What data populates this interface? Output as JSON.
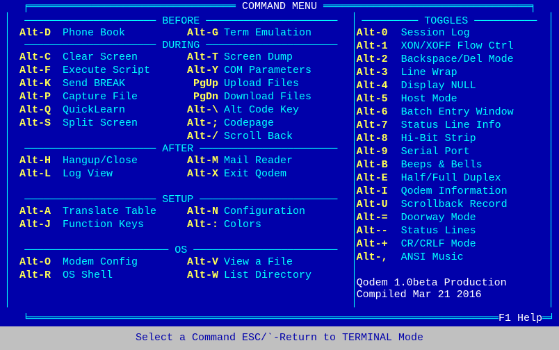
{
  "title": "COMMAND MENU",
  "left": {
    "sections": [
      {
        "name": "BEFORE",
        "rows": [
          {
            "k1": "Alt-D",
            "l1": "Phone Book",
            "k2": "Alt-G",
            "l2": "Term Emulation"
          }
        ]
      },
      {
        "name": "DURING",
        "rows": [
          {
            "k1": "Alt-C",
            "l1": "Clear Screen",
            "k2": "Alt-T",
            "l2": "Screen Dump"
          },
          {
            "k1": "Alt-F",
            "l1": "Execute Script",
            "k2": "Alt-Y",
            "l2": "COM Parameters"
          },
          {
            "k1": "Alt-K",
            "l1": "Send BREAK",
            "k2": "PgUp",
            "l2": "Upload Files"
          },
          {
            "k1": "Alt-P",
            "l1": "Capture File",
            "k2": "PgDn",
            "l2": "Download Files"
          },
          {
            "k1": "Alt-Q",
            "l1": "QuickLearn",
            "k2": "Alt-\\",
            "l2": "Alt Code Key"
          },
          {
            "k1": "Alt-S",
            "l1": "Split Screen",
            "k2": "Alt-;",
            "l2": "Codepage"
          },
          {
            "k1": "",
            "l1": "",
            "k2": "Alt-/",
            "l2": "Scroll Back"
          }
        ]
      },
      {
        "name": "AFTER",
        "rows": [
          {
            "k1": "Alt-H",
            "l1": "Hangup/Close",
            "k2": "Alt-M",
            "l2": "Mail Reader"
          },
          {
            "k1": "Alt-L",
            "l1": "Log View",
            "k2": "Alt-X",
            "l2": "Exit Qodem"
          }
        ]
      },
      {
        "name": "SETUP",
        "rows": [
          {
            "k1": "Alt-A",
            "l1": "Translate Table",
            "k2": "Alt-N",
            "l2": "Configuration"
          },
          {
            "k1": "Alt-J",
            "l1": "Function Keys",
            "k2": "Alt-:",
            "l2": "Colors"
          }
        ]
      },
      {
        "name": "OS",
        "rows": [
          {
            "k1": "Alt-O",
            "l1": "Modem Config",
            "k2": "Alt-V",
            "l2": "View a File"
          },
          {
            "k1": "Alt-R",
            "l1": "OS Shell",
            "k2": "Alt-W",
            "l2": "List Directory"
          }
        ]
      }
    ]
  },
  "right": {
    "section": "TOGGLES",
    "rows": [
      {
        "k": "Alt-0",
        "l": "Session Log"
      },
      {
        "k": "Alt-1",
        "l": "XON/XOFF Flow Ctrl"
      },
      {
        "k": "Alt-2",
        "l": "Backspace/Del Mode"
      },
      {
        "k": "Alt-3",
        "l": "Line Wrap"
      },
      {
        "k": "Alt-4",
        "l": "Display NULL"
      },
      {
        "k": "Alt-5",
        "l": "Host Mode"
      },
      {
        "k": "Alt-6",
        "l": "Batch Entry Window"
      },
      {
        "k": "Alt-7",
        "l": "Status Line Info"
      },
      {
        "k": "Alt-8",
        "l": "Hi-Bit Strip"
      },
      {
        "k": "Alt-9",
        "l": "Serial Port"
      },
      {
        "k": "Alt-B",
        "l": "Beeps & Bells"
      },
      {
        "k": "Alt-E",
        "l": "Half/Full Duplex"
      },
      {
        "k": "Alt-I",
        "l": "Qodem Information"
      },
      {
        "k": "Alt-U",
        "l": "Scrollback Record"
      },
      {
        "k": "Alt-=",
        "l": "Doorway Mode"
      },
      {
        "k": "Alt--",
        "l": "Status Lines"
      },
      {
        "k": "Alt-+",
        "l": "CR/CRLF Mode"
      },
      {
        "k": "Alt-,",
        "l": "ANSI Music"
      }
    ],
    "footer1": "Qodem 1.0beta Production",
    "footer2": "Compiled Mar 21 2016"
  },
  "help": "F1 Help",
  "statusbar": "Select a Command   ESC/`-Return to TERMINAL Mode"
}
